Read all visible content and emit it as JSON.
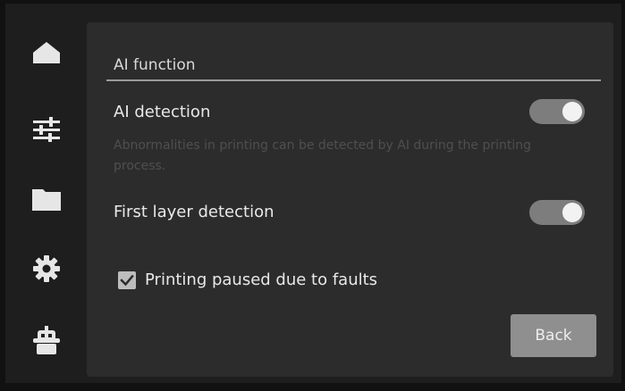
{
  "sidebar": {
    "items": [
      {
        "icon": "home-icon"
      },
      {
        "icon": "sliders-icon"
      },
      {
        "icon": "folder-icon"
      },
      {
        "icon": "gear-icon"
      },
      {
        "icon": "robot-icon"
      }
    ],
    "icon_color": "#e6e6e6"
  },
  "section": {
    "title": "AI function"
  },
  "settings": {
    "ai_detection": {
      "label": "AI detection",
      "description": "Abnormalities in printing can be detected by AI during the printing process.",
      "enabled": true
    },
    "first_layer_detection": {
      "label": "First layer detection",
      "enabled": true
    },
    "pause_on_fault": {
      "label": "Printing paused due to faults",
      "checked": true
    }
  },
  "actions": {
    "back_label": "Back"
  },
  "colors": {
    "background": "#1e1e1e",
    "panel": "#2c2c2c",
    "toggle_track": "#7d7d7d",
    "toggle_knob": "#f2f2f2",
    "button": "#8f8f8f"
  }
}
